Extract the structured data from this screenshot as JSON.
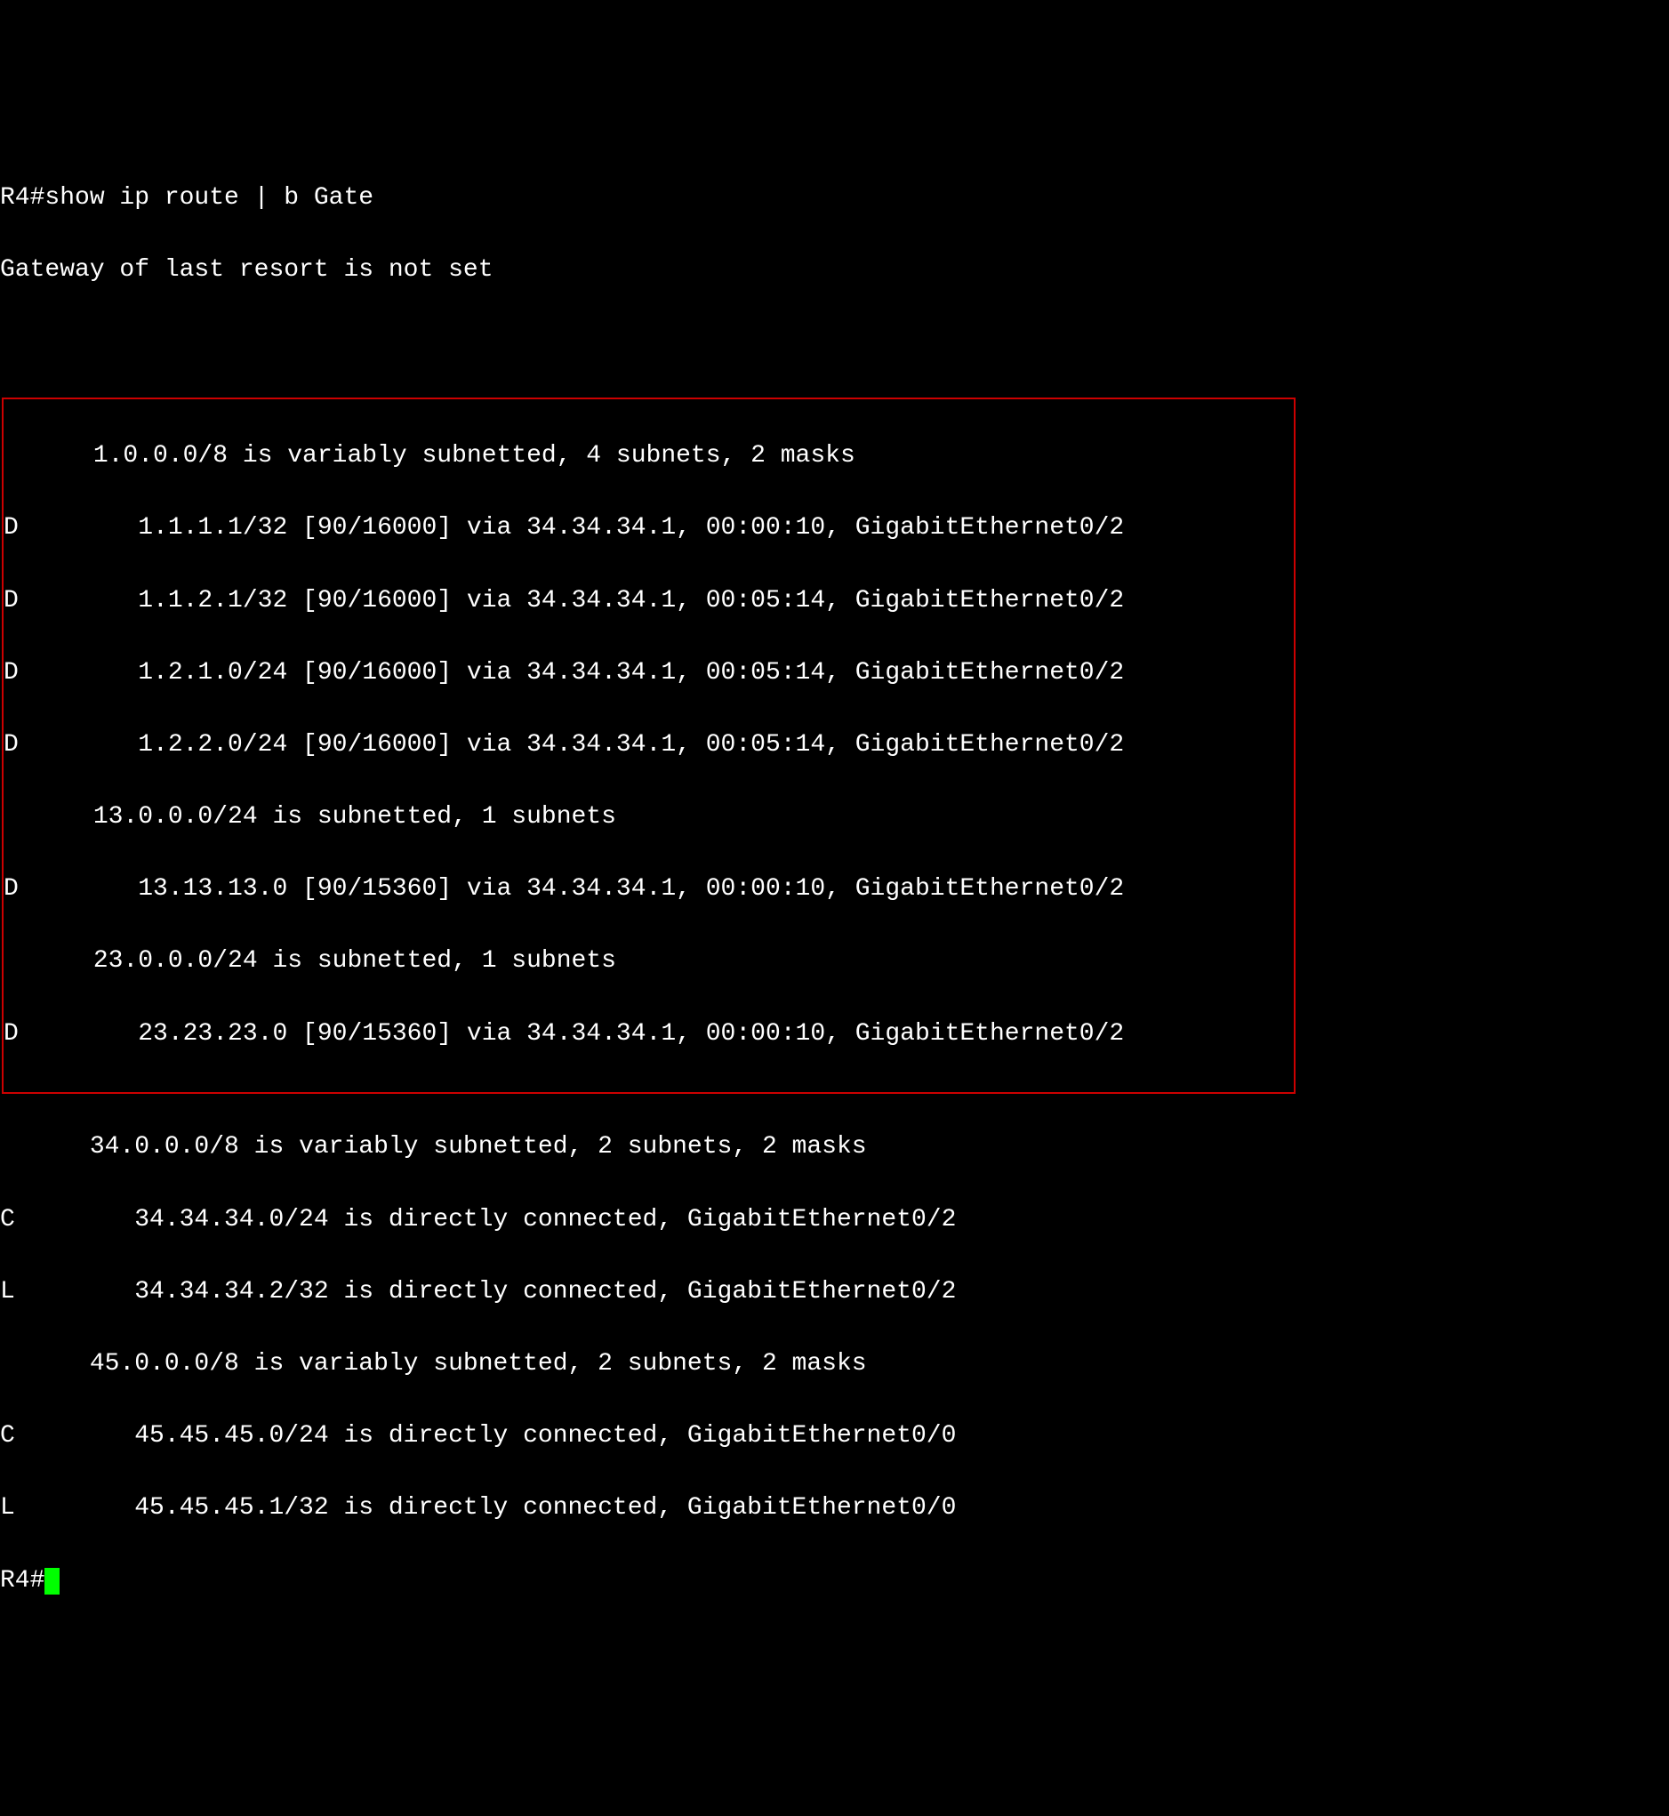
{
  "terminal": {
    "command_line": "R4#show ip route | b Gate",
    "gateway_line": "Gateway of last resort is not set",
    "blank_line": " ",
    "highlighted": {
      "line1": "      1.0.0.0/8 is variably subnetted, 4 subnets, 2 masks",
      "line2": "D        1.1.1.1/32 [90/16000] via 34.34.34.1, 00:00:10, GigabitEthernet0/2",
      "line3": "D        1.1.2.1/32 [90/16000] via 34.34.34.1, 00:05:14, GigabitEthernet0/2",
      "line4": "D        1.2.1.0/24 [90/16000] via 34.34.34.1, 00:05:14, GigabitEthernet0/2",
      "line5": "D        1.2.2.0/24 [90/16000] via 34.34.34.1, 00:05:14, GigabitEthernet0/2",
      "line6": "      13.0.0.0/24 is subnetted, 1 subnets",
      "line7": "D        13.13.13.0 [90/15360] via 34.34.34.1, 00:00:10, GigabitEthernet0/2",
      "line8": "      23.0.0.0/24 is subnetted, 1 subnets",
      "line9": "D        23.23.23.0 [90/15360] via 34.34.34.1, 00:00:10, GigabitEthernet0/2"
    },
    "rest": {
      "line1": "      34.0.0.0/8 is variably subnetted, 2 subnets, 2 masks",
      "line2": "C        34.34.34.0/24 is directly connected, GigabitEthernet0/2",
      "line3": "L        34.34.34.2/32 is directly connected, GigabitEthernet0/2",
      "line4": "      45.0.0.0/8 is variably subnetted, 2 subnets, 2 masks",
      "line5": "C        45.45.45.0/24 is directly connected, GigabitEthernet0/0",
      "line6": "L        45.45.45.1/32 is directly connected, GigabitEthernet0/0"
    },
    "prompt": "R4#"
  }
}
